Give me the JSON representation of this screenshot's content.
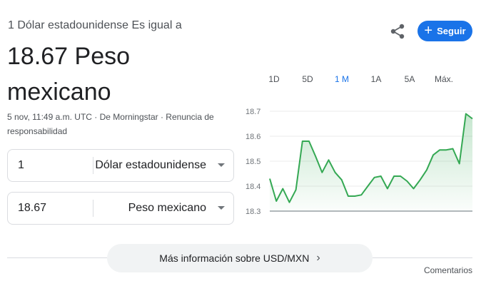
{
  "header": {
    "subtitle": "1 Dólar estadounidense Es igual a",
    "result": "18.67 Peso mexicano",
    "meta_text": "5 nov, 11:49 a.m. UTC · De Morningstar · Renuncia de responsabilidad"
  },
  "actions": {
    "share_icon": "share-icon",
    "follow_label": "Seguir",
    "follow_color": "#1a73e8"
  },
  "converter": {
    "from_amount": "1",
    "from_currency": "Dólar estadounidense",
    "to_amount": "18.67",
    "to_currency": "Peso mexicano"
  },
  "ranges": [
    "1D",
    "5D",
    "1 M",
    "1A",
    "5A",
    "Máx."
  ],
  "active_range": "1 M",
  "chart_data": {
    "type": "area",
    "y_ticks": [
      "18.7",
      "18.6",
      "18.5",
      "18.4",
      "18.3"
    ],
    "ylim": [
      18.3,
      18.7
    ],
    "line_color": "#34a853",
    "values": [
      18.43,
      18.34,
      18.39,
      18.335,
      18.385,
      18.58,
      18.58,
      18.52,
      18.455,
      18.505,
      18.455,
      18.425,
      18.36,
      18.36,
      18.365,
      18.4,
      18.435,
      18.44,
      18.39,
      18.44,
      18.44,
      18.42,
      18.39,
      18.425,
      18.465,
      18.525,
      18.545,
      18.545,
      18.55,
      18.49,
      18.69,
      18.67
    ]
  },
  "footer": {
    "more_info": "Más información sobre USD/MXN",
    "comments": "Comentarios"
  }
}
